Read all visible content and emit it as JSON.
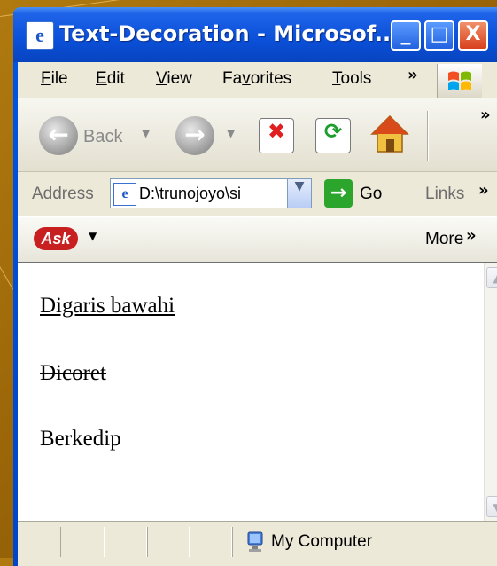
{
  "window": {
    "title": "Text-Decoration - Microsof...",
    "title_icon": "e",
    "controls": {
      "minimize": "_",
      "maximize": "□",
      "close": "X"
    }
  },
  "menubar": {
    "items": [
      {
        "label_first": "F",
        "label_rest": "ile"
      },
      {
        "label_first": "E",
        "label_rest": "dit"
      },
      {
        "label_first": "V",
        "label_rest": "iew"
      },
      {
        "label_first": "Fa",
        "label_mid": "v",
        "label_rest": "orites"
      },
      {
        "label_first": "T",
        "label_rest": "ools"
      }
    ],
    "overflow": "»"
  },
  "toolbar": {
    "back_label": "Back",
    "overflow": "»"
  },
  "addressbar": {
    "label": "Address",
    "value": "D:\\trunojoyo\\si",
    "go_label": "Go",
    "links_label": "Links",
    "overflow": "»"
  },
  "askbar": {
    "logo": "Ask",
    "more_label": "More"
  },
  "content": {
    "lines": [
      {
        "text": "Digaris bawahi",
        "style": "underline"
      },
      {
        "text": "Dicoret",
        "style": "line-through"
      },
      {
        "text": "Berkedip",
        "style": "blink"
      }
    ]
  },
  "statusbar": {
    "zone": "My Computer"
  },
  "colors": {
    "background": "#9a6508",
    "titlebar": "#0a50d8",
    "close_button": "#d8401c",
    "client": "#ece9d8"
  }
}
